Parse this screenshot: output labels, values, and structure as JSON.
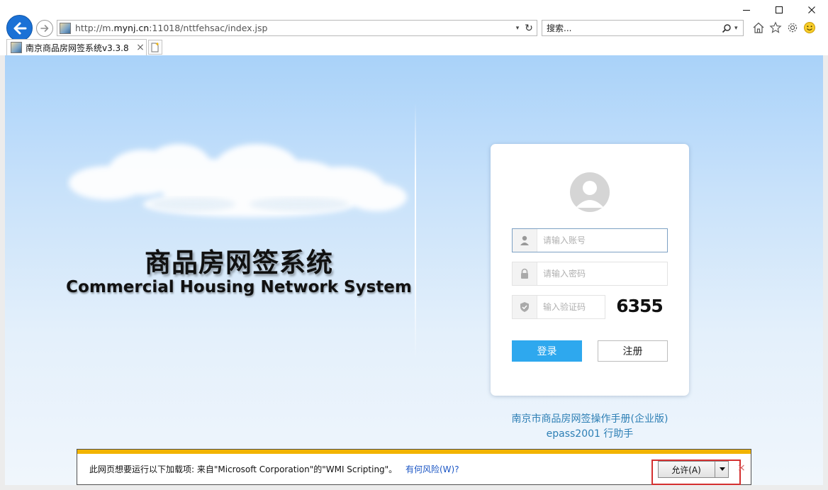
{
  "browser": {
    "url_prefix": "http://m.",
    "url_domain": "mynj.cn",
    "url_suffix": ":11018/nttfehsac/index.jsp",
    "search_placeholder": "搜索...",
    "tab_title": "南京商品房网签系统v3.3.8",
    "tab_close": "×",
    "refresh_glyph": "↻",
    "dropdown_glyph": "▾"
  },
  "window_controls": {
    "minimize_icon": "minimize-icon",
    "maximize_icon": "maximize-icon",
    "close_icon": "close-icon"
  },
  "page": {
    "title_cn": "商品房网签系统",
    "title_en": "Commercial Housing Network System"
  },
  "login": {
    "account_placeholder": "请输入账号",
    "password_placeholder": "请输入密码",
    "captcha_placeholder": "输入验证码",
    "captcha_code": "6355",
    "login_label": "登录",
    "register_label": "注册",
    "accent_color": "#2ea8ee"
  },
  "links": {
    "manual": "南京市商品房网签操作手册(企业版)",
    "epass": "epass2001 行助手"
  },
  "notification": {
    "message": "此网页想要运行以下加载项: 来自\"Microsoft Corporation\"的\"WMI Scripting\"。",
    "risk_link": "有何风险(W)?",
    "allow_label": "允许(A)",
    "close_glyph": "×",
    "stripe_color": "#f2b400",
    "highlight_color": "#d43030"
  }
}
